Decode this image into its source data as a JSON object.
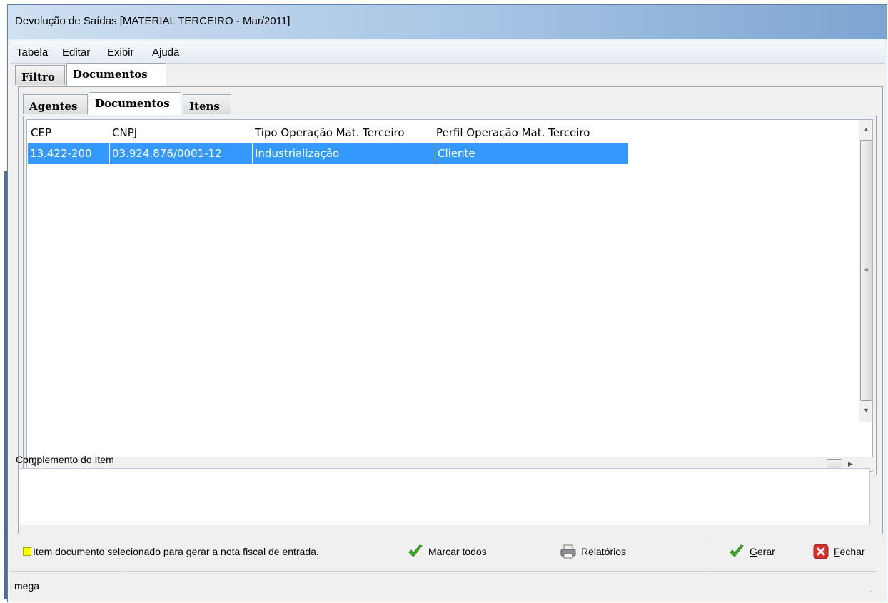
{
  "window": {
    "title": "Devolução de Saídas [MATERIAL TERCEIRO - Mar/2011]"
  },
  "menu": [
    "Tabela",
    "Editar",
    "Exibir",
    "Ajuda"
  ],
  "outer_tabs": [
    "Filtro",
    "Documentos"
  ],
  "outer_active": "Documentos",
  "inner_tabs": [
    "Agentes",
    "Documentos",
    "Itens"
  ],
  "inner_active": "Documentos",
  "grid": {
    "columns": [
      "CEP",
      "CNPJ",
      "Tipo Operação Mat. Terceiro",
      "Perfil Operação Mat. Terceiro"
    ],
    "rows": [
      {
        "cep": "13.422-200",
        "cnpj": "03.924.876/0001-12",
        "tipo": "Industrialização",
        "perfil": "Cliente",
        "selected": true
      }
    ]
  },
  "complemento": {
    "label": "Complemento do Item",
    "value": ""
  },
  "legend": {
    "text": "Item documento selecionado para gerar a nota fiscal de entrada.",
    "color": "#ffff00"
  },
  "buttons": {
    "marcar_todos": "Marcar todos",
    "relatorios": "Relatórios",
    "gerar_rest": "erar",
    "gerar_key": "G",
    "fechar_rest": "echar",
    "fechar_key": "F"
  },
  "status": {
    "user": "mega"
  },
  "icons": {
    "check": "check-icon",
    "printer": "printer-icon",
    "close": "close-icon"
  },
  "colors": {
    "selection": "#3399ff",
    "accent_green": "#3cae24",
    "close_red": "#d8302a"
  }
}
